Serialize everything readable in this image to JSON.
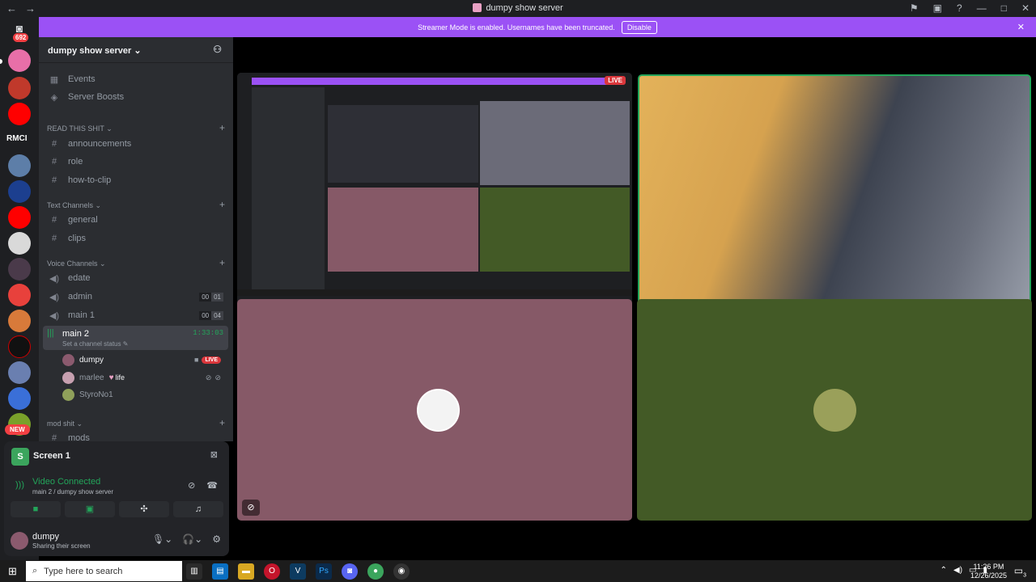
{
  "window": {
    "title": "dumpy show server",
    "back": "←",
    "forward": "→"
  },
  "rail": {
    "badge": "692",
    "rmci": "RMCI",
    "new_label": "NEW"
  },
  "banner": {
    "text": "Streamer Mode is enabled. Usernames have been truncated.",
    "button": "Disable"
  },
  "server": {
    "name": "dumpy show server"
  },
  "sidebar": {
    "events": "Events",
    "boosts": "Server Boosts",
    "categories": {
      "read": "READ THIS SHIT",
      "text": "Text Channels",
      "voice": "Voice Channels",
      "mod": "mod shit"
    },
    "channels": {
      "announcements": "announcements",
      "role": "role",
      "how_to_clip": "how-to-clip",
      "general": "general",
      "clips": "clips",
      "edate": "edate",
      "admin": "admin",
      "admin_count": [
        "00",
        "01"
      ],
      "main1": "main 1",
      "main1_count": [
        "00",
        "04"
      ],
      "main2": "main 2",
      "main2_timer": "1:33:03",
      "main2_status": "Set a channel status",
      "mods": "mods"
    },
    "voice_users": [
      {
        "name": "dumpy",
        "badge": "LIVE"
      },
      {
        "name": "marlee",
        "tag": "life"
      },
      {
        "name": "StyroNo1"
      }
    ]
  },
  "voice_panel": {
    "screen_title": "Screen 1",
    "connected": "Video Connected",
    "location": "main 2 / dumpy show server",
    "user_name": "dumpy",
    "user_status": "Sharing their screen"
  },
  "stage": {
    "live": "LIVE"
  },
  "taskbar": {
    "search_placeholder": "Type here to search",
    "time": "11:26 PM",
    "date": "12/26/2025",
    "notif_count": "3"
  }
}
